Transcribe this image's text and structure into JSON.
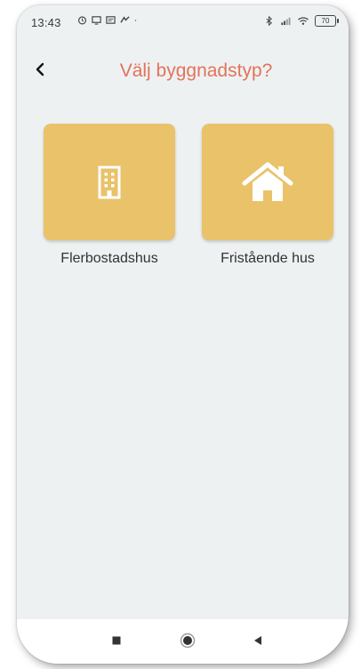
{
  "status_bar": {
    "time": "13:43",
    "battery": "70",
    "left_icons": [
      "alarm-icon",
      "cast-icon",
      "message-icon",
      "app-icon",
      "dot-icon"
    ],
    "right_icons": [
      "bluetooth-icon",
      "signal-icon",
      "wifi-icon",
      "battery-icon"
    ]
  },
  "header": {
    "title": "Välj byggnadstyp?",
    "back_icon": "chevron-left-icon"
  },
  "options": [
    {
      "label": "Flerbostadshus",
      "icon": "apartment-building-icon"
    },
    {
      "label": "Fristående hus",
      "icon": "house-icon"
    }
  ],
  "nav_bar": {
    "buttons": [
      "recent-apps-icon",
      "home-icon",
      "back-triangle-icon"
    ]
  },
  "colors": {
    "background": "#eef1f2",
    "title": "#e2735b",
    "tile": "#e9c26a",
    "label": "#333333"
  }
}
